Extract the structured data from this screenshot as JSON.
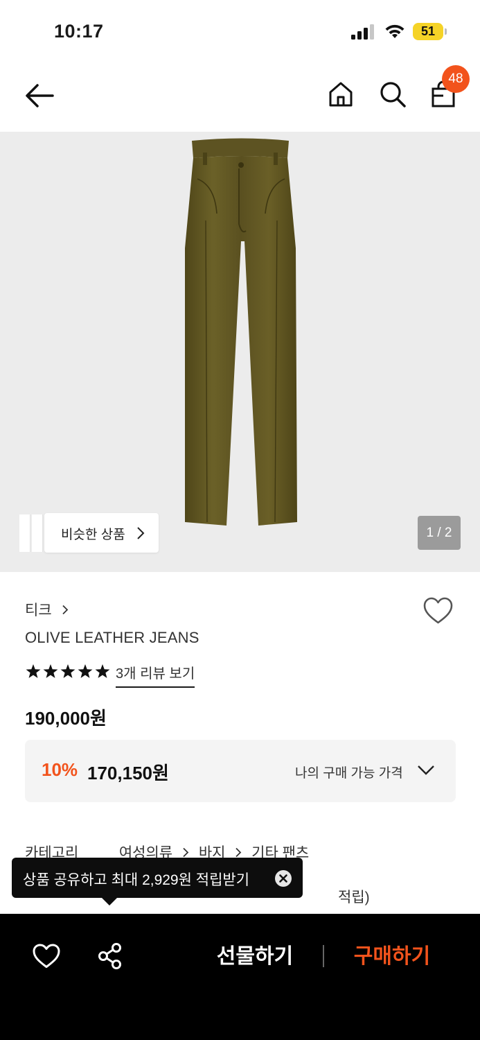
{
  "status_bar": {
    "time": "10:17",
    "battery": "51",
    "battery_color": "#f5d327",
    "icons": [
      "cellular-signal-icon",
      "wifi-icon",
      "battery-icon"
    ]
  },
  "nav": {
    "back_icon": "back-arrow-icon",
    "home_icon": "home-icon",
    "search_icon": "search-icon",
    "bag_icon": "shopping-bag-icon",
    "bag_count": "48"
  },
  "hero": {
    "similar_label": "비슷한 상품",
    "page_indicator": "1 / 2"
  },
  "product": {
    "brand": "티크",
    "title": "OLIVE LEATHER JEANS",
    "stars": 5,
    "review_link": "3개 리뷰 보기",
    "original_price": "190,000원",
    "discount_percent": "10%",
    "discount_price": "170,150원",
    "my_price_label": "나의 구매 가능 가격"
  },
  "category": {
    "label": "카테고리",
    "path": [
      "여성의류",
      "바지",
      "기타 팬츠"
    ]
  },
  "points_row": {
    "tail_text": "적립)"
  },
  "tooltip": {
    "text": "상품 공유하고 최대 2,929원 적립받기"
  },
  "bottom_bar": {
    "gift_label": "선물하기",
    "buy_label": "구매하기"
  },
  "colors": {
    "accent": "#f2531c",
    "hero_bg": "#ececec",
    "product": "#5e5422"
  }
}
